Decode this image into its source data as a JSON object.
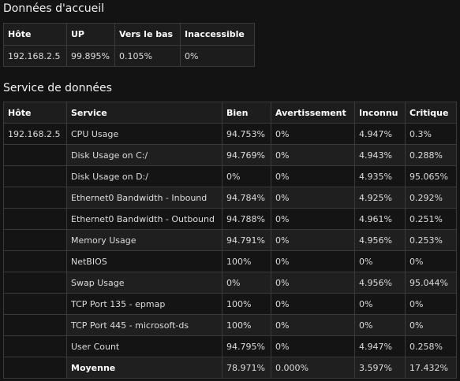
{
  "accueil": {
    "title": "Données d'accueil",
    "headers": [
      "Hôte",
      "UP",
      "Vers le bas",
      "Inaccessible"
    ],
    "row": [
      "192.168.2.5",
      "99.895%",
      "0.105%",
      "0%"
    ]
  },
  "service": {
    "title": "Service de données",
    "headers": [
      "Hôte",
      "Service",
      "Bien",
      "Avertissement",
      "Inconnu",
      "Critique"
    ],
    "host": "192.168.2.5",
    "rows": [
      [
        "CPU Usage",
        "94.753%",
        "0%",
        "4.947%",
        "0.3%"
      ],
      [
        "Disk Usage on C:/",
        "94.769%",
        "0%",
        "4.943%",
        "0.288%"
      ],
      [
        "Disk Usage on D:/",
        "0%",
        "0%",
        "4.935%",
        "95.065%"
      ],
      [
        "Ethernet0 Bandwidth - Inbound",
        "94.784%",
        "0%",
        "4.925%",
        "0.292%"
      ],
      [
        "Ethernet0 Bandwidth - Outbound",
        "94.788%",
        "0%",
        "4.961%",
        "0.251%"
      ],
      [
        "Memory Usage",
        "94.791%",
        "0%",
        "4.956%",
        "0.253%"
      ],
      [
        "NetBIOS",
        "100%",
        "0%",
        "0%",
        "0%"
      ],
      [
        "Swap Usage",
        "0%",
        "0%",
        "4.956%",
        "95.044%"
      ],
      [
        "TCP Port 135 - epmap",
        "100%",
        "0%",
        "0%",
        "0%"
      ],
      [
        "TCP Port 445 - microsoft-ds",
        "100%",
        "0%",
        "0%",
        "0%"
      ],
      [
        "User Count",
        "94.795%",
        "0%",
        "4.947%",
        "0.258%"
      ]
    ],
    "average": {
      "label": "Moyenne",
      "values": [
        "78.971%",
        "0.000%",
        "3.597%",
        "17.432%"
      ]
    }
  }
}
